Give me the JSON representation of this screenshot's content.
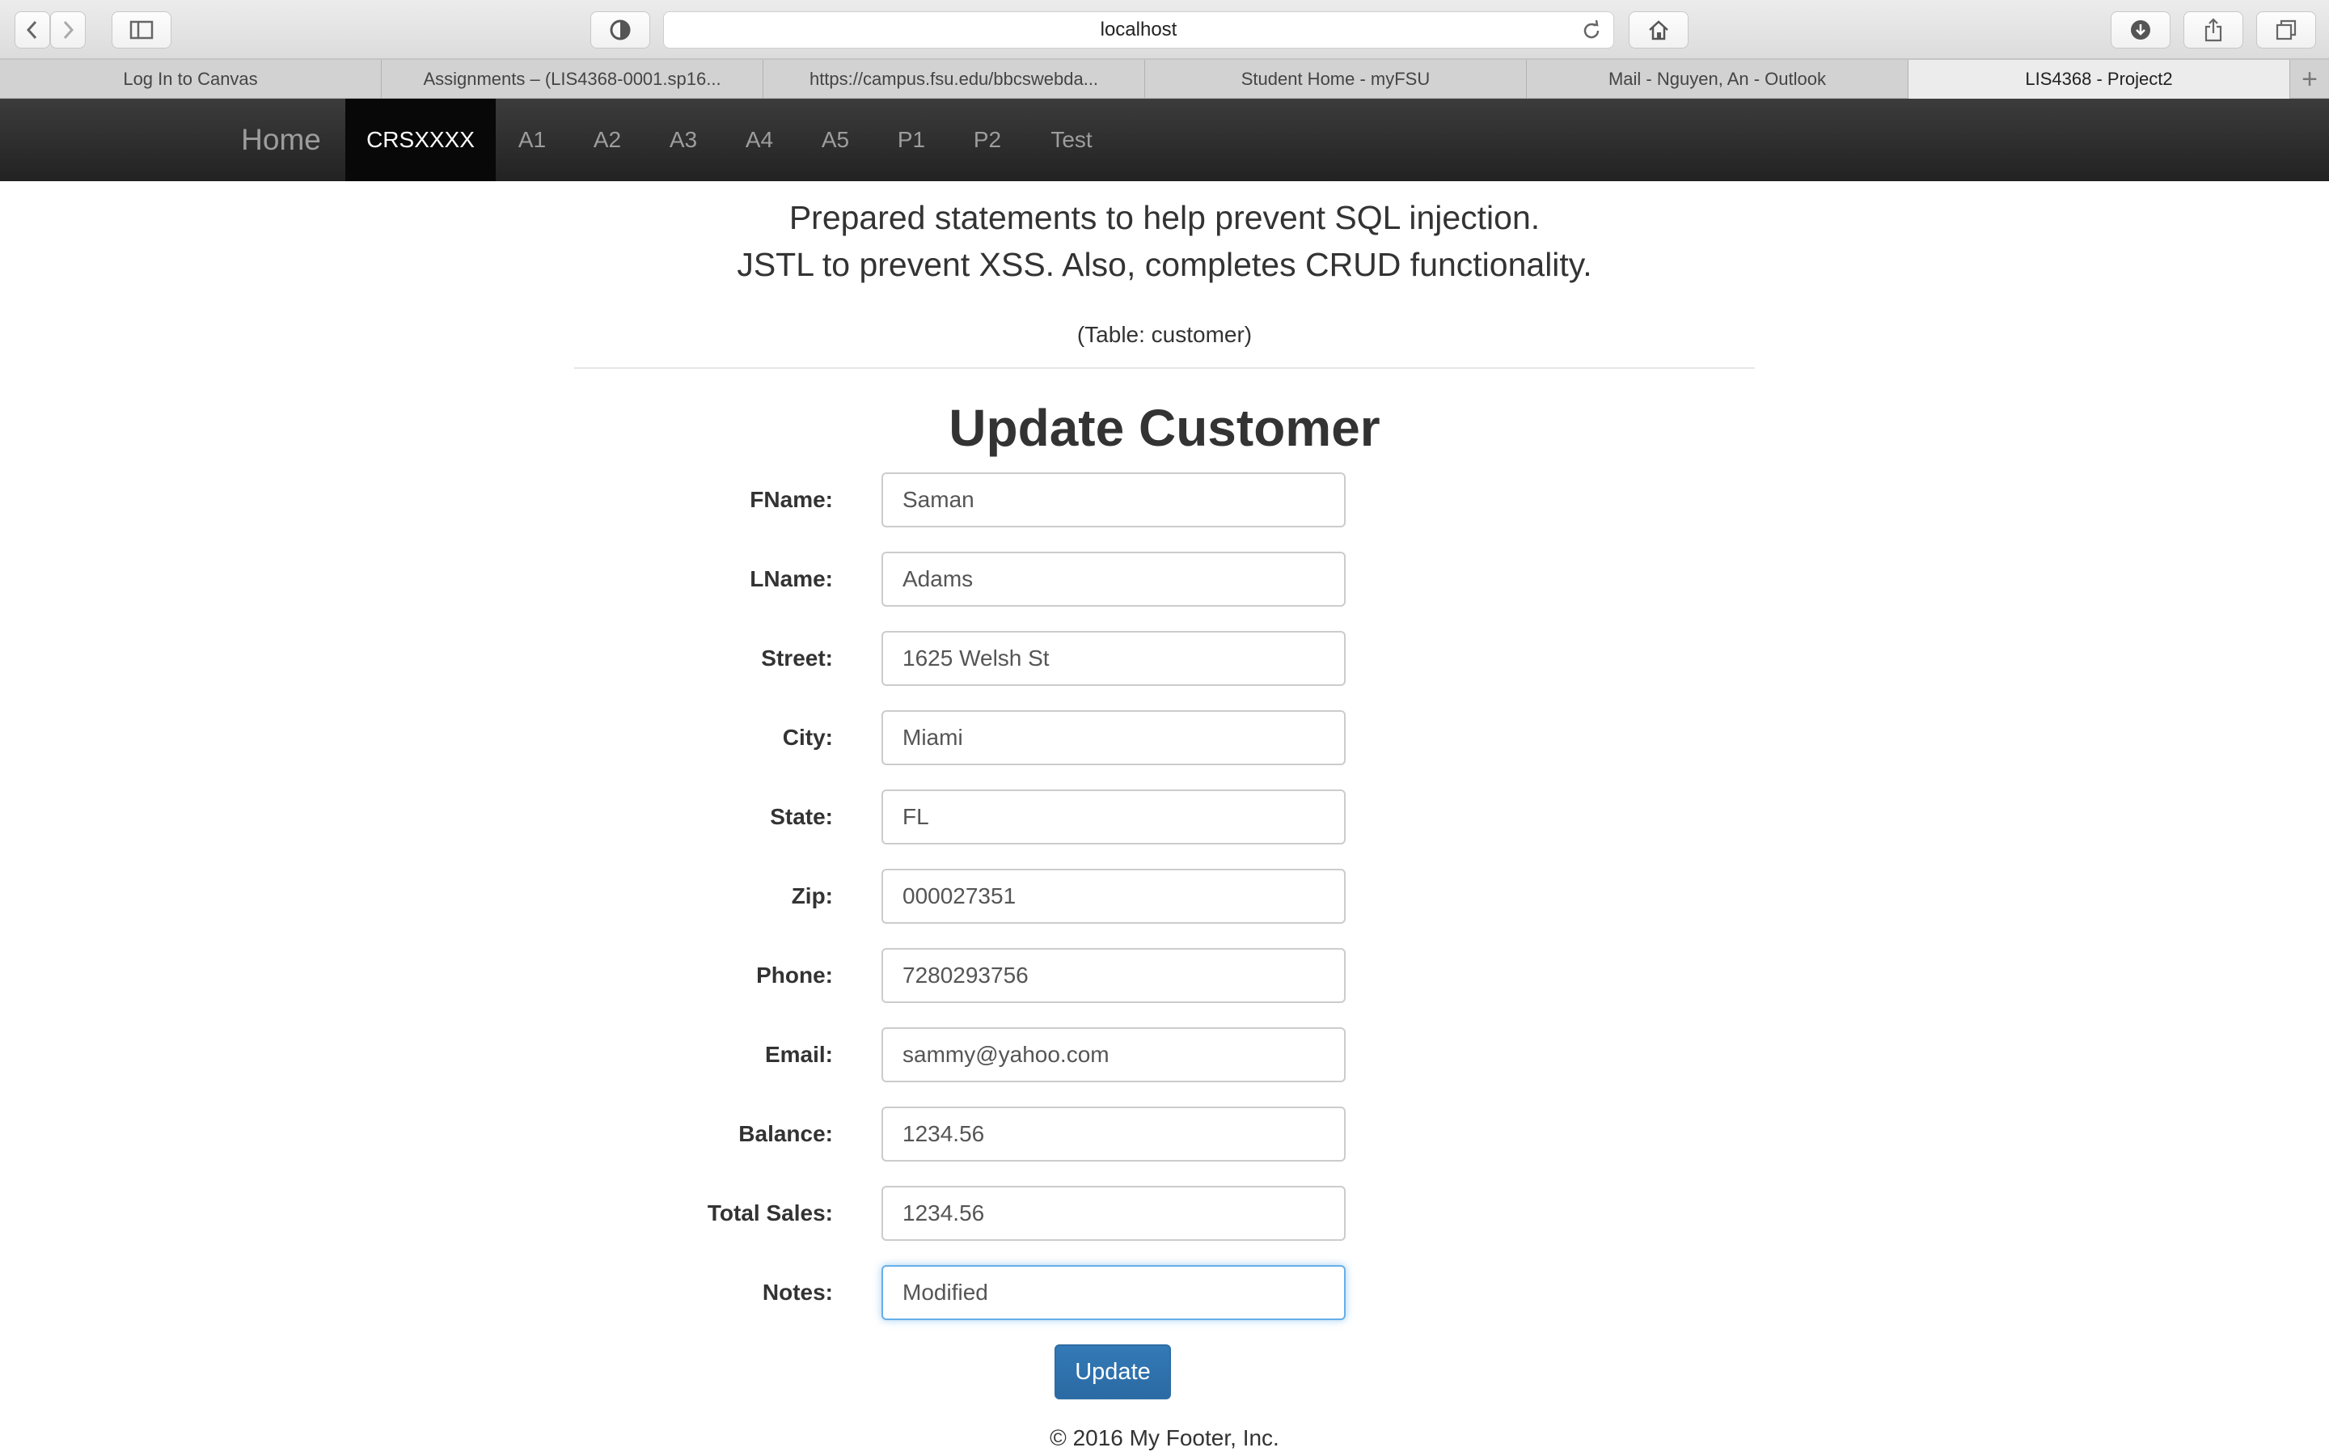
{
  "browser": {
    "address": "localhost",
    "tabs": [
      {
        "label": "Log In to Canvas"
      },
      {
        "label": "Assignments – (LIS4368-0001.sp16..."
      },
      {
        "label": "https://campus.fsu.edu/bbcswebda..."
      },
      {
        "label": "Student Home - myFSU"
      },
      {
        "label": "Mail - Nguyen, An - Outlook"
      },
      {
        "label": "LIS4368 - Project2"
      }
    ],
    "new_tab": "+"
  },
  "navbar": {
    "brand": "Home",
    "items": [
      {
        "label": "CRSXXXX",
        "active": true
      },
      {
        "label": "A1"
      },
      {
        "label": "A2"
      },
      {
        "label": "A3"
      },
      {
        "label": "A4"
      },
      {
        "label": "A5"
      },
      {
        "label": "P1"
      },
      {
        "label": "P2"
      },
      {
        "label": "Test"
      }
    ]
  },
  "header": {
    "line1": "Prepared statements to help prevent SQL injection.",
    "line2": "JSTL to prevent XSS. Also, completes CRUD functionality.",
    "table_note": "(Table: customer)"
  },
  "form": {
    "title": "Update Customer",
    "fields": [
      {
        "label": "FName:",
        "value": "Saman"
      },
      {
        "label": "LName:",
        "value": "Adams"
      },
      {
        "label": "Street:",
        "value": "1625 Welsh St"
      },
      {
        "label": "City:",
        "value": "Miami"
      },
      {
        "label": "State:",
        "value": "FL"
      },
      {
        "label": "Zip:",
        "value": "000027351"
      },
      {
        "label": "Phone:",
        "value": "7280293756"
      },
      {
        "label": "Email:",
        "value": "sammy@yahoo.com"
      },
      {
        "label": "Balance:",
        "value": "1234.56"
      },
      {
        "label": "Total Sales:",
        "value": "1234.56"
      },
      {
        "label": "Notes:",
        "value": "Modified"
      }
    ],
    "submit_label": "Update"
  },
  "footer": {
    "text": "© 2016 My Footer, Inc."
  },
  "colors": {
    "navbar": "#222222",
    "active_nav": "#080808",
    "primary_button": "#337ab7",
    "focus_border": "#66afe9"
  }
}
